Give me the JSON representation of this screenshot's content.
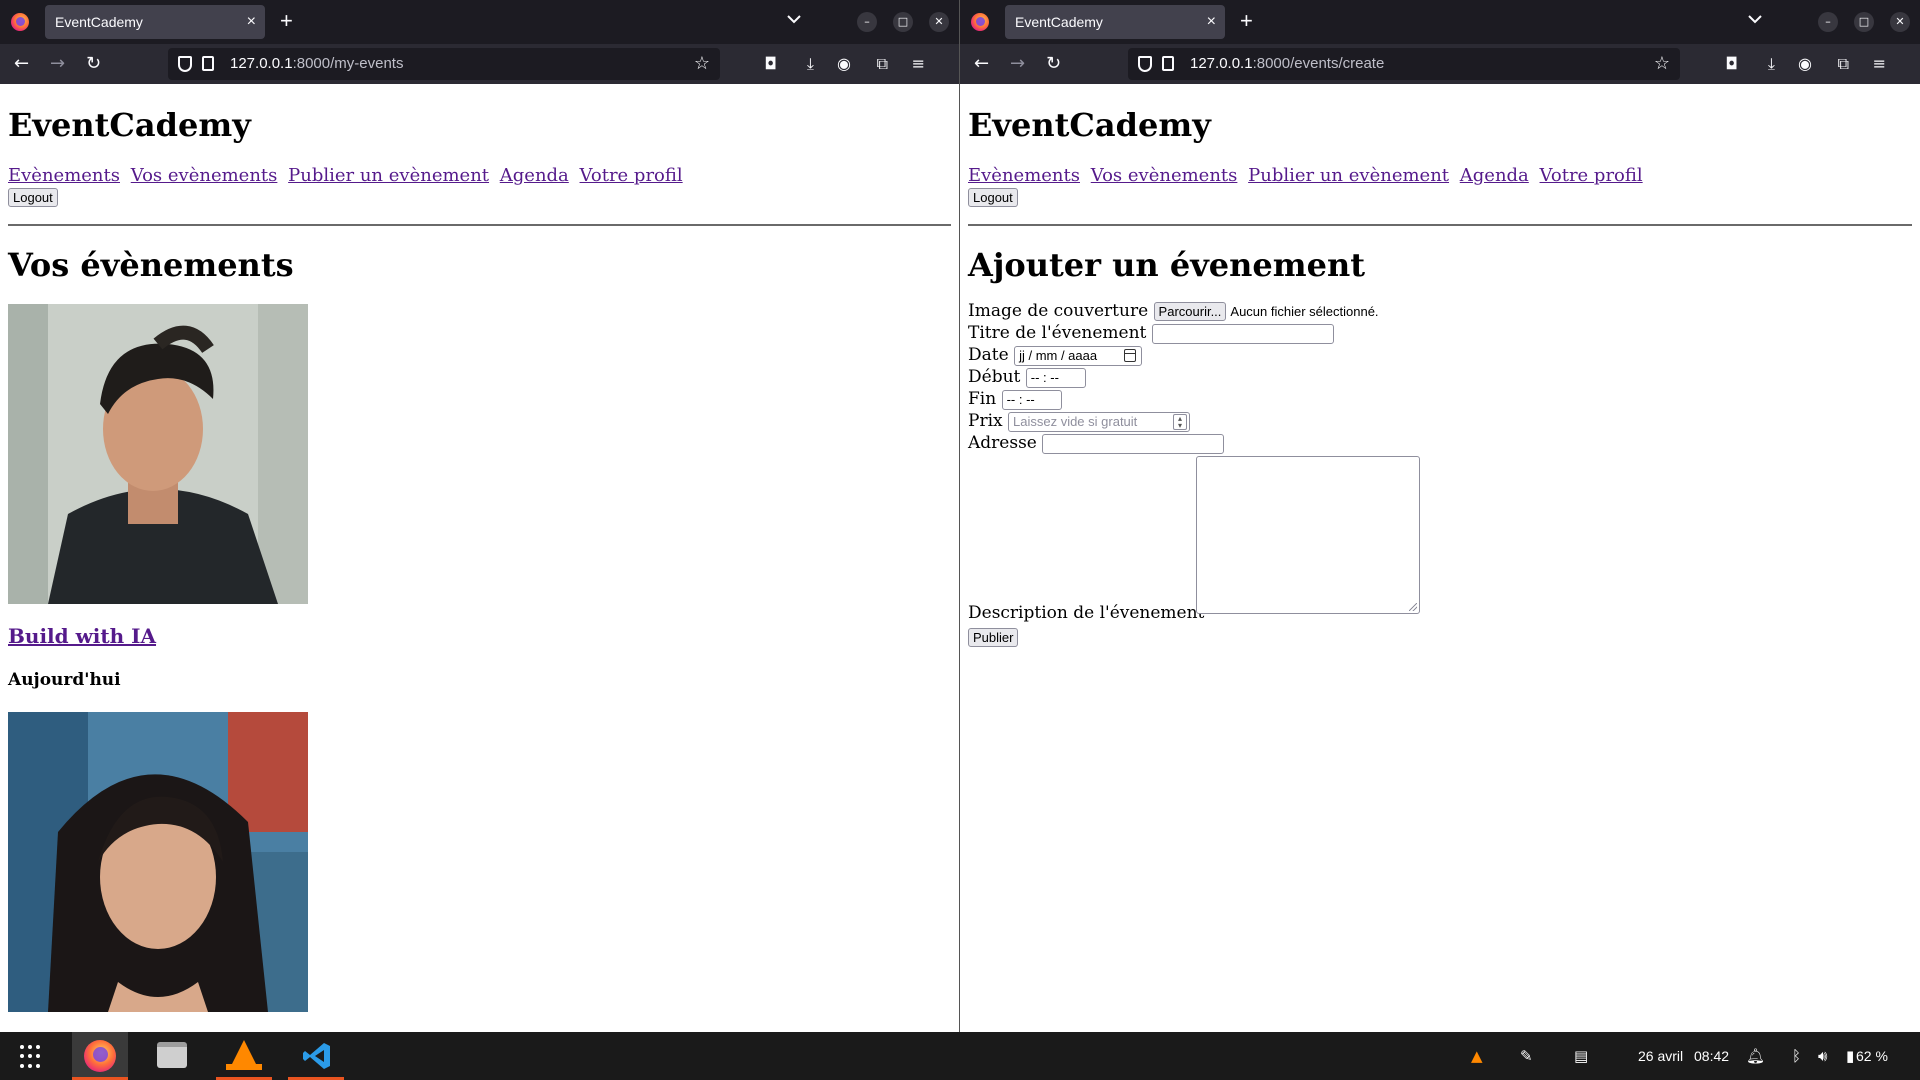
{
  "left_window": {
    "tab": {
      "title": "EventCademy",
      "close": "×"
    },
    "new_tab": "+",
    "url": {
      "host": "127.0.0.1",
      "path": ":8000/my-events"
    },
    "page": {
      "site_title": "EventCademy",
      "nav": [
        "Evènements",
        "Vos evènements",
        "Publier un evènement",
        "Agenda",
        "Votre profil"
      ],
      "logout": "Logout",
      "heading": "Vos évènements",
      "events": [
        {
          "title": "Build with IA",
          "date": "Aujourd'hui"
        }
      ]
    }
  },
  "right_window": {
    "tab": {
      "title": "EventCademy",
      "close": "×"
    },
    "new_tab": "+",
    "url": {
      "host": "127.0.0.1",
      "path": ":8000/events/create"
    },
    "page": {
      "site_title": "EventCademy",
      "nav": [
        "Evènements",
        "Vos evènements",
        "Publier un evènement",
        "Agenda",
        "Votre profil"
      ],
      "logout": "Logout",
      "heading": "Ajouter un évenement",
      "form": {
        "cover_label": "Image de couverture",
        "browse_button": "Parcourir...",
        "file_status": "Aucun fichier sélectionné.",
        "title_label": "Titre de l'évenement",
        "date_label": "Date",
        "date_value": "jj / mm / aaaa",
        "start_label": "Début",
        "start_value": "-- : --",
        "end_label": "Fin",
        "end_value": "-- : --",
        "price_label": "Prix",
        "price_placeholder": "Laissez vide si gratuit",
        "address_label": "Adresse",
        "description_label": "Description de l'évenement",
        "submit": "Publier"
      }
    }
  },
  "taskbar": {
    "date": "26 avril",
    "time": "08:42",
    "battery": "62 %",
    "accent": "#e95420"
  }
}
